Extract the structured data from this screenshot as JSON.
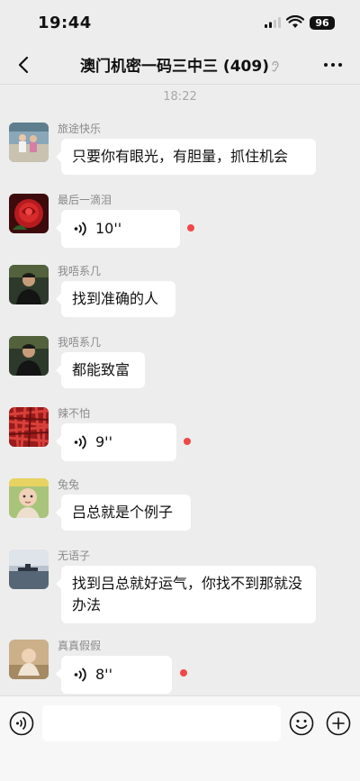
{
  "status": {
    "time": "19:44",
    "battery": "96"
  },
  "header": {
    "back_icon": "chevron-left-icon",
    "title": "澳门机密一码三中三 (409)",
    "ear_icon": "ear-icon",
    "more_icon": "more-icon"
  },
  "chat": {
    "timestamp": "18:22",
    "messages": [
      {
        "sender": "旅途快乐",
        "type": "text",
        "text": "只要你有眼光，有胆量，抓住机会"
      },
      {
        "sender": "最后一滴泪",
        "type": "voice",
        "duration": "10''",
        "unread": true
      },
      {
        "sender": "我唔系几",
        "type": "text",
        "text": "找到准确的人"
      },
      {
        "sender": "我唔系几",
        "type": "text",
        "text": "都能致富"
      },
      {
        "sender": "辣不怕",
        "type": "voice",
        "duration": "9''",
        "unread": true
      },
      {
        "sender": "兔兔",
        "type": "text",
        "text": "吕总就是个例子"
      },
      {
        "sender": "无语子",
        "type": "text",
        "text": "找到吕总就好运气，你找不到那就没办法"
      },
      {
        "sender": "真真假假",
        "type": "voice",
        "duration": "8''",
        "unread": true
      }
    ]
  },
  "input_bar": {
    "voice_icon": "voice-input-icon",
    "emoji_icon": "emoji-icon",
    "plus_icon": "plus-icon",
    "placeholder": ""
  },
  "colors": {
    "background": "#ededed",
    "bubble": "#ffffff",
    "unread_dot": "#f04848"
  }
}
